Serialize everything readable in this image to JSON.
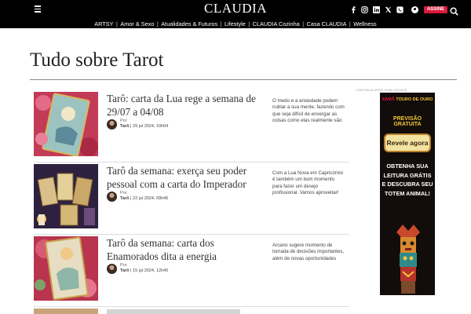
{
  "header": {
    "logo": "CLAUDIA",
    "subscribe_label": "ASSINE",
    "social": [
      {
        "name": "facebook-icon",
        "glyph": "f"
      },
      {
        "name": "instagram-icon",
        "glyph": ""
      },
      {
        "name": "linkedin-icon",
        "glyph": "in"
      },
      {
        "name": "x-icon",
        "glyph": "𝕏"
      },
      {
        "name": "whatsapp-icon",
        "glyph": ""
      }
    ]
  },
  "nav": {
    "items": [
      "ARTSY",
      "Amor & Sexo",
      "Atualidades & Futuros",
      "Lifestyle",
      "CLAUDIA Cozinha",
      "Casa CLAUDIA",
      "Wellness"
    ]
  },
  "page": {
    "title": "Tudo sobre Tarot"
  },
  "articles": [
    {
      "title": "Tarô: carta da Lua rege a semana de 29/07 a 04/08",
      "by_label": "Por",
      "author": "Tarô",
      "date": "29 jul 2024, 10h04",
      "summary": "O medo e a ansiedade podem nublar a sua mente, fazendo com que seja difícil de enxergar as coisas como elas realmente são"
    },
    {
      "title": "Tarô da semana: exerça seu poder pessoal com a carta do Imperador",
      "by_label": "Por",
      "author": "Tarô",
      "date": "22 jul 2024, 09h45",
      "summary": "Com a Lua Nova em Capricórnio é também um bom momento para fazer um desejo profissional. Vamos aproveitar!"
    },
    {
      "title": "Tarô da semana: carta dos Enamorados dita a energia",
      "by_label": "Por",
      "author": "Tarô",
      "date": "15 jul 2024, 12h40",
      "summary": "Arcano sugere momento de tomada de decisões importantes, além de novas oportunidades"
    }
  ],
  "ad": {
    "label": "CONTINUA APÓS PUBLICIDADE",
    "brand_prefix": "XAMÃ",
    "brand_name": "TOURO DE OURO",
    "promo": "PREVISÃO GRATUITA",
    "cta": "Revele agora",
    "copy": "OBTENHA SUA LEITURA GRÁTIS E DESCUBRA SEU TOTEM ANIMAL!"
  },
  "colors": {
    "header_bg": "#000000",
    "subscribe_bg": "#d81b3c",
    "ad_accent": "#f3c63c"
  }
}
